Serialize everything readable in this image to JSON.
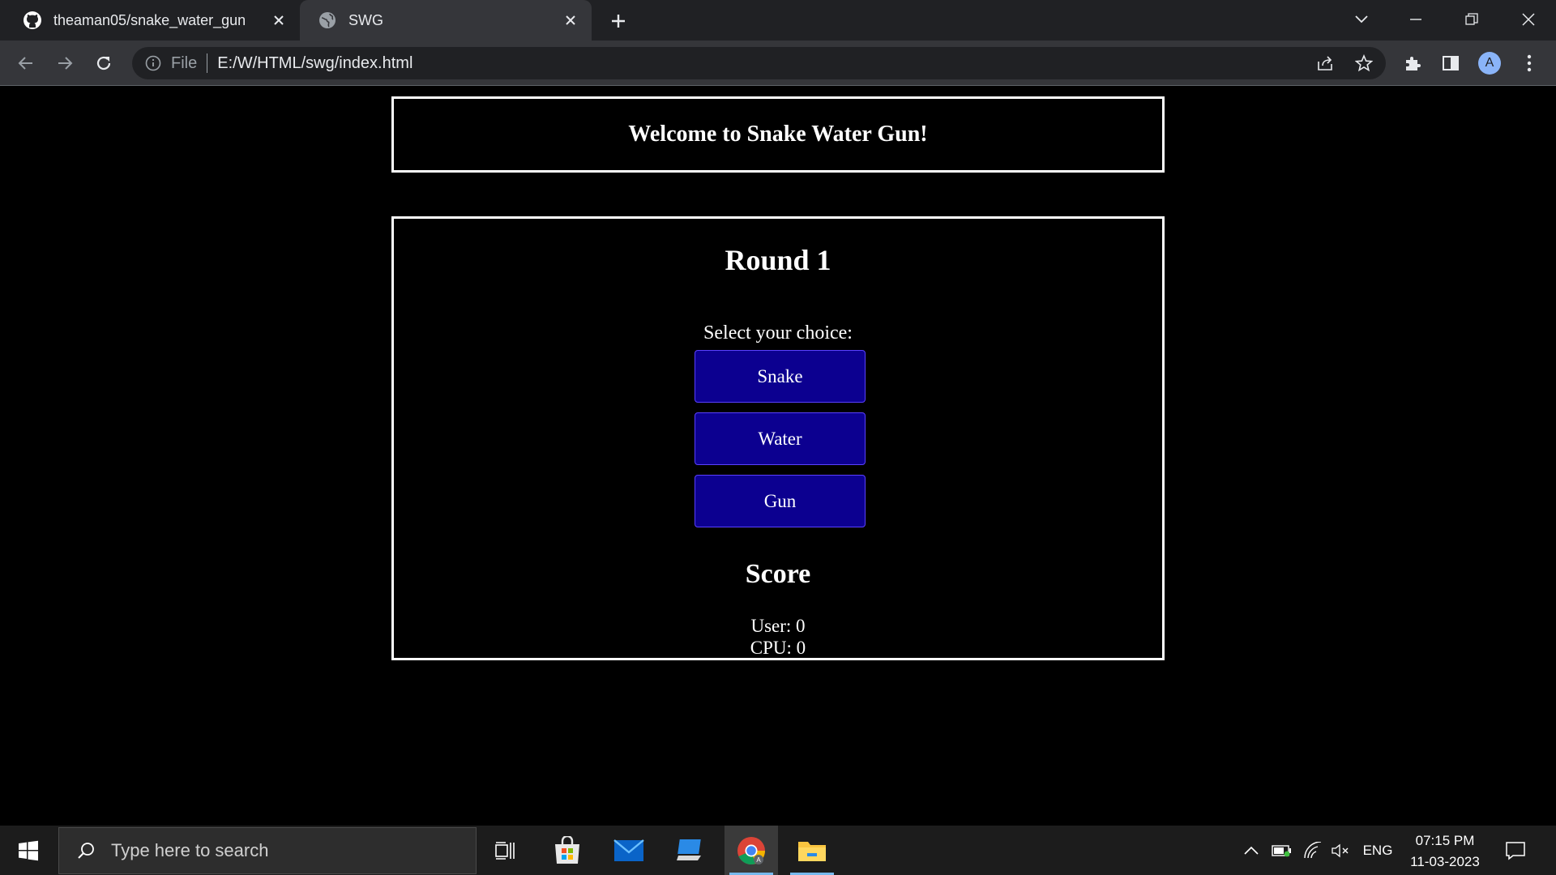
{
  "browser": {
    "tabs": [
      {
        "title": "theaman05/snake_water_gun",
        "icon": "github-icon"
      },
      {
        "title": "SWG",
        "icon": "globe-icon"
      }
    ],
    "address": {
      "scheme_label": "File",
      "url": "E:/W/HTML/swg/index.html"
    },
    "profile_initial": "A"
  },
  "page": {
    "header": "Welcome to Snake Water Gun!",
    "round_title": "Round 1",
    "select_label": "Select your choice:",
    "choices": [
      "Snake",
      "Water",
      "Gun"
    ],
    "score_title": "Score",
    "user_score": "User: 0",
    "cpu_score": "CPU: 0",
    "colors": {
      "button_bg": "#0c0090",
      "button_border": "#5a40ff",
      "background": "#000000",
      "border": "#ffffff"
    }
  },
  "taskbar": {
    "search_placeholder": "Type here to search",
    "apps": [
      "task-view-icon",
      "microsoft-store-icon",
      "mail-icon",
      "remote-desktop-icon",
      "chrome-icon",
      "file-explorer-icon"
    ],
    "language": "ENG",
    "time": "07:15 PM",
    "date": "11-03-2023"
  }
}
